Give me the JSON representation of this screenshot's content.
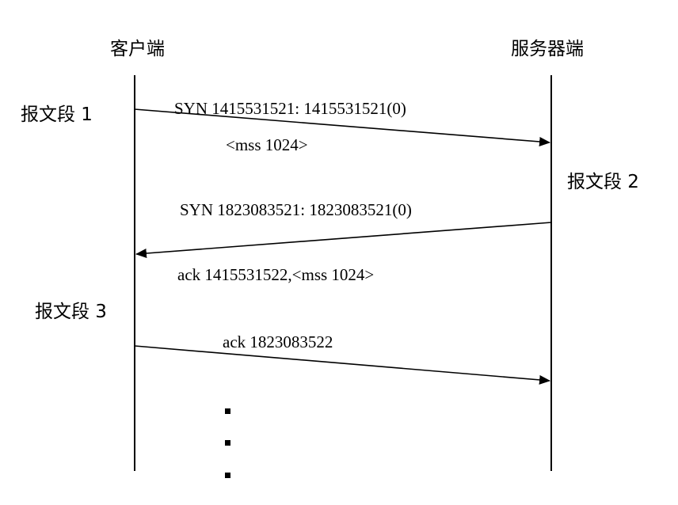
{
  "lifelines": {
    "client_label": "客户端",
    "server_label": "服务器端"
  },
  "segments": [
    {
      "label": "报文段 1",
      "direction": "client-to-server",
      "line1": "SYN 1415531521: 1415531521(0)",
      "line2": "<mss 1024>"
    },
    {
      "label": "报文段 2",
      "direction": "server-to-client",
      "line1": "SYN 1823083521: 1823083521(0)",
      "line2": "ack 1415531522,<mss 1024>"
    },
    {
      "label": "报文段 3",
      "direction": "client-to-server",
      "line1": "ack 1823083522"
    }
  ],
  "continuation": "⋮",
  "colors": {
    "ink": "#000000",
    "background": "#ffffff"
  }
}
